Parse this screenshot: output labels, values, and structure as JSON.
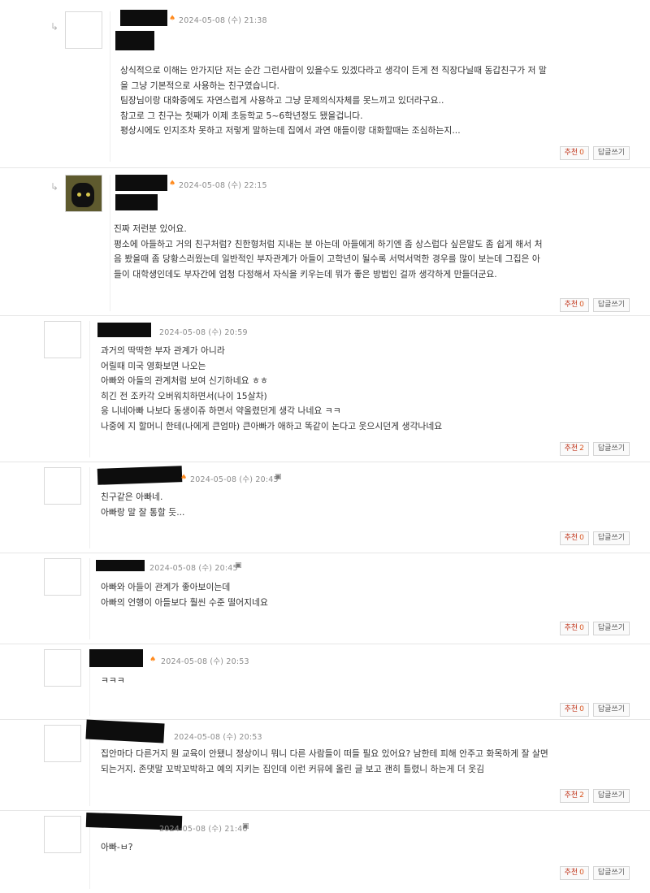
{
  "buttons": {
    "like_label": "추천",
    "reply_label": "답글쓰기"
  },
  "comments": [
    {
      "date": "2024-05-08 (수) 21:38",
      "mark": "",
      "body": "상식적으로 이해는 안가지단 저는 순간 그런사람이 있을수도 있겠다라고 생각이 든게 전 직장다닐때 동갑친구가 저 말\n을 그냥 기본적으로 사용하는 친구였습니다.\n팀장님이랑 대화중에도 자연스럽게 사용하고 그냥 문제의식자체를 못느끼고 있더라구요..\n참고로 그 친구는 첫째가 이제 초등학교 5~6학년정도 됐을겁니다.\n평상시에도 인지조차 못하고 저렇게 말하는데 집에서 과연 애들이랑 대화할때는 조심하는지...",
      "likes": "0"
    },
    {
      "date": "2024-05-08 (수) 22:15",
      "mark": "",
      "body": "진짜 저런분 있어요.\n평소에 아들하고 거의 친구처럼? 친한형처럼 지내는 분 아는데 아들에게 하기엔 좀 상스럽다 싶은말도 좀 쉽게 해서 처\n음 봤을때 좀 당황스러웠는데 일반적인 부자관계가 아들이 고학년이 될수록 서먹서먹한 경우를 많이 보는데 그집은 아\n들이 대학생인데도 부자간에 엄청 다정해서 자식을 키우는데 뭐가 좋은 방법인 걸까 생각하게 만들더군요.",
      "likes": "0"
    },
    {
      "date": "2024-05-08 (수) 20:59",
      "mark": "",
      "body": "과거의 딱딱한 부자 관계가 아니라\n어릴때 미국 영화보면 나오는\n아빠와 아들의 관계처럼 보여 신기하네요 ㅎㅎ\n히긴 전 조카각 오버워치하면서(나이 15살차)\n응 니네아빠 나보다 동생이쥬 하면서 약올렸던게 생각 나네요 ㅋㅋ\n나중에 지 할머니 한테(나에게 큰엄마) 큰아빠가 애하고 똑같이 논다고 웃으시던게 생각나네요",
      "likes": "2"
    },
    {
      "date": "2024-05-08 (수) 20:45",
      "mark": "▣",
      "body": "친구같은 아빠네.\n아빠랑 말 잘 통할 듯...",
      "likes": "0"
    },
    {
      "date": "2024-05-08 (수) 20:45",
      "mark": "▣",
      "body": "아빠와 아들이 관계가 좋아보이는데\n아빠의 언행이 아들보다 훨씬 수준 떨어지네요",
      "likes": "0"
    },
    {
      "date": "2024-05-08 (수) 20:53",
      "mark": "",
      "body": "ㅋㅋㅋ",
      "likes": "0"
    },
    {
      "date": "2024-05-08 (수) 20:53",
      "mark": "",
      "body": "집안마다 다른거지 뭔 교육이 안됐니 정상이니 뭐니 다른 사람들이 떠들 필요 있어요? 남한테 피해 안주고 화목하게 잘 살면\n되는거지. 존댓말 꼬박꼬박하고 예의 지키는 집인데 이런 커뮤에 올린 글 보고 괜히 틀렸니 하는게 더 웃김",
      "likes": "2"
    },
    {
      "date": "2024-05-08 (수) 21:40",
      "mark": "▣",
      "body": "아빠-ㅂ?",
      "likes": "0"
    }
  ]
}
